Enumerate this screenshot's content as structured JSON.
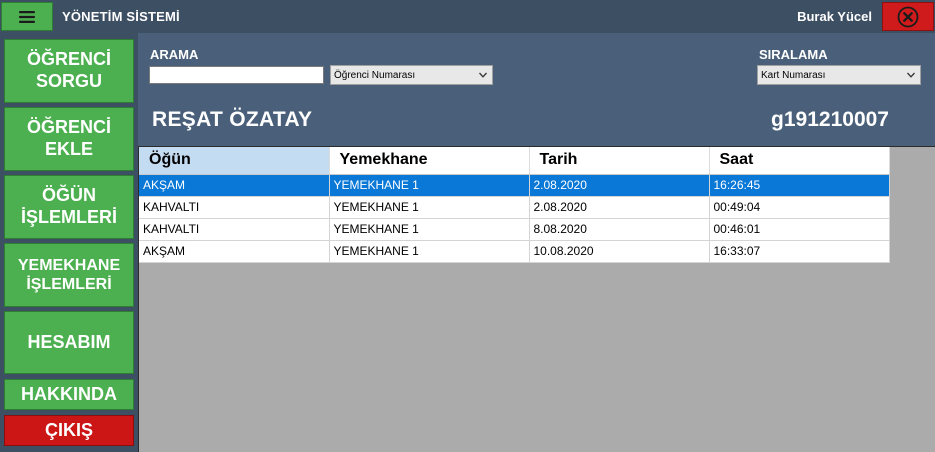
{
  "titlebar": {
    "menu_icon": "hamburger-icon",
    "app_title": "YÖNETİM SİSTEMİ",
    "user_name": "Burak Yücel",
    "close_icon": "close-circle-icon"
  },
  "sidebar": {
    "items": [
      {
        "line1": "ÖĞRENCİ",
        "line2": "SORGU"
      },
      {
        "line1": "ÖĞRENCİ",
        "line2": "EKLE"
      },
      {
        "line1": "ÖĞÜN",
        "line2": "İŞLEMLERİ"
      },
      {
        "line1": "YEMEKHANE",
        "line2": "İŞLEMLERİ"
      },
      {
        "line1": "HESABIM",
        "line2": ""
      },
      {
        "line1": "HAKKINDA",
        "line2": ""
      },
      {
        "line1": "ÇIKIŞ",
        "line2": ""
      }
    ]
  },
  "search": {
    "label": "ARAMA",
    "value": "",
    "field_select": "Öğrenci Numarası"
  },
  "sort": {
    "label": "SIRALAMA",
    "select": "Kart Numarası"
  },
  "student": {
    "name": "REŞAT ÖZATAY",
    "number": "g191210007"
  },
  "table": {
    "headers": [
      "Öğün",
      "Yemekhane",
      "Tarih",
      "Saat"
    ],
    "rows": [
      {
        "ogun": "AKŞAM",
        "yemekhane": "YEMEKHANE 1",
        "tarih": "2.08.2020",
        "saat": "16:26:45"
      },
      {
        "ogun": "KAHVALTI",
        "yemekhane": "YEMEKHANE 1",
        "tarih": "2.08.2020",
        "saat": "00:49:04"
      },
      {
        "ogun": "KAHVALTI",
        "yemekhane": "YEMEKHANE 1",
        "tarih": "8.08.2020",
        "saat": "00:46:01"
      },
      {
        "ogun": "AKŞAM",
        "yemekhane": "YEMEKHANE 1",
        "tarih": "10.08.2020",
        "saat": "16:33:07"
      }
    ],
    "selected_row": 0
  },
  "colors": {
    "background": "#3d4f63",
    "panel": "#4a607a",
    "nav_green": "#4caf50",
    "exit_red": "#cc1515",
    "selection": "#0a78d7",
    "grid_bg": "#ababab"
  }
}
